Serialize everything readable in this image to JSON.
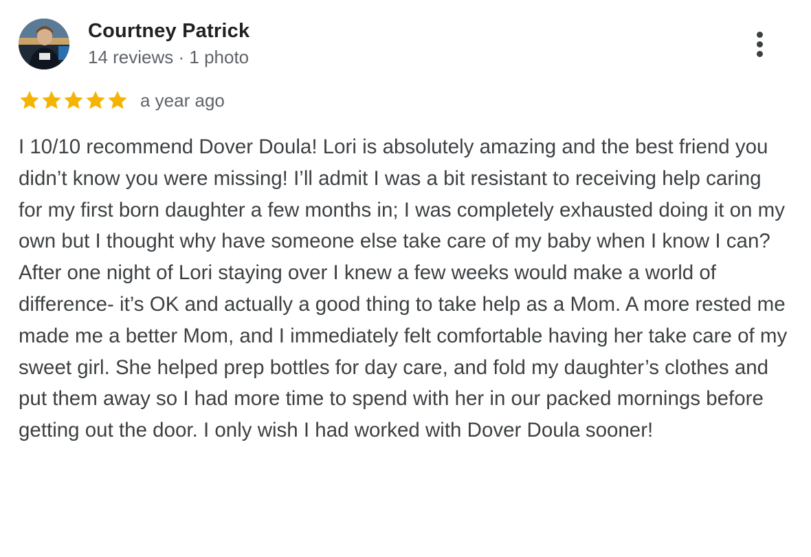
{
  "reviewer": {
    "name": "Courtney Patrick",
    "meta": "14 reviews · 1 photo",
    "avatar_icon": "profile-photo"
  },
  "rating": {
    "stars": 5,
    "max_stars": 5,
    "star_color": "#f4b400",
    "date": "a year ago"
  },
  "more_menu": {
    "icon": "more-vert-icon"
  },
  "review": {
    "text": "I 10/10 recommend Dover Doula! Lori is absolutely amazing and the best friend you didn’t know you were missing! I’ll admit I was a bit resistant to receiving help caring for my first born daughter a few months in; I was completely exhausted doing it on my own but I thought why have someone else take care of my baby when I know I can? After one night of Lori staying over I knew a few weeks would make a world of difference- it’s OK and actually a good thing to take help as a Mom. A more rested me made me a better Mom, and I immediately felt comfortable having her take care of my sweet girl. She helped prep bottles for day care, and fold my daughter’s clothes and put them away so I had more time to spend with her in our packed mornings before getting out the door. I only wish I had worked with Dover Doula sooner!"
  }
}
